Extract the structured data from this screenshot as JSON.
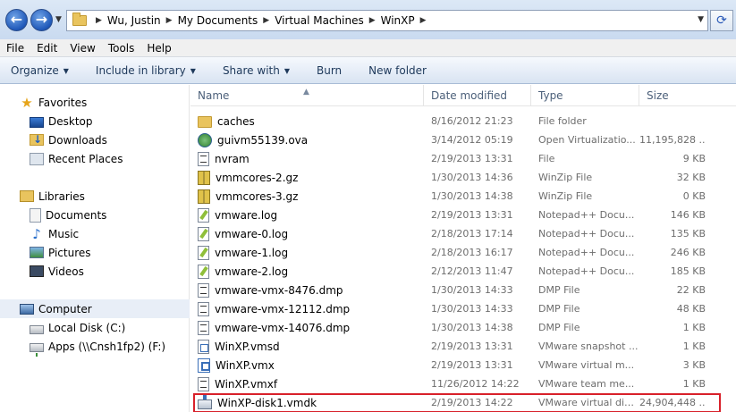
{
  "address": {
    "breadcrumbs": [
      "Wu, Justin",
      "My Documents",
      "Virtual Machines",
      "WinXP"
    ]
  },
  "menu": [
    "File",
    "Edit",
    "View",
    "Tools",
    "Help"
  ],
  "commands": {
    "organize": "Organize",
    "include_in_library": "Include in library",
    "share_with": "Share with",
    "burn": "Burn",
    "new_folder": "New folder"
  },
  "nav": {
    "favorites": "Favorites",
    "desktop": "Desktop",
    "downloads": "Downloads",
    "recent_places": "Recent Places",
    "libraries": "Libraries",
    "documents": "Documents",
    "music": "Music",
    "pictures": "Pictures",
    "videos": "Videos",
    "computer": "Computer",
    "local_disk": "Local Disk (C:)",
    "apps": "Apps (\\\\Cnsh1fp2) (F:)"
  },
  "columns": {
    "name": "Name",
    "date_modified": "Date modified",
    "type": "Type",
    "size": "Size"
  },
  "files": [
    {
      "name": "caches",
      "date": "8/16/2012 21:23",
      "type": "File folder",
      "size": "",
      "icon": "folder-icon"
    },
    {
      "name": "guivm55139.ova",
      "date": "3/14/2012 05:19",
      "type": "Open Virtualizatio...",
      "size": "11,195,828 ...",
      "icon": "ova-icon"
    },
    {
      "name": "nvram",
      "date": "2/19/2013 13:31",
      "type": "File",
      "size": "9 KB",
      "icon": "file-icon"
    },
    {
      "name": "vmmcores-2.gz",
      "date": "1/30/2013 14:36",
      "type": "WinZip File",
      "size": "32 KB",
      "icon": "zip-icon"
    },
    {
      "name": "vmmcores-3.gz",
      "date": "1/30/2013 14:38",
      "type": "WinZip File",
      "size": "0 KB",
      "icon": "zip-icon"
    },
    {
      "name": "vmware.log",
      "date": "2/19/2013 13:31",
      "type": "Notepad++ Docu...",
      "size": "146 KB",
      "icon": "notepad-icon"
    },
    {
      "name": "vmware-0.log",
      "date": "2/18/2013 17:14",
      "type": "Notepad++ Docu...",
      "size": "135 KB",
      "icon": "notepad-icon"
    },
    {
      "name": "vmware-1.log",
      "date": "2/18/2013 16:17",
      "type": "Notepad++ Docu...",
      "size": "246 KB",
      "icon": "notepad-icon"
    },
    {
      "name": "vmware-2.log",
      "date": "2/12/2013 11:47",
      "type": "Notepad++ Docu...",
      "size": "185 KB",
      "icon": "notepad-icon"
    },
    {
      "name": "vmware-vmx-8476.dmp",
      "date": "1/30/2013 14:33",
      "type": "DMP File",
      "size": "22 KB",
      "icon": "file-icon"
    },
    {
      "name": "vmware-vmx-12112.dmp",
      "date": "1/30/2013 14:33",
      "type": "DMP File",
      "size": "48 KB",
      "icon": "file-icon"
    },
    {
      "name": "vmware-vmx-14076.dmp",
      "date": "1/30/2013 14:38",
      "type": "DMP File",
      "size": "1 KB",
      "icon": "file-icon"
    },
    {
      "name": "WinXP.vmsd",
      "date": "2/19/2013 13:31",
      "type": "VMware snapshot ...",
      "size": "1 KB",
      "icon": "vmsd-icon"
    },
    {
      "name": "WinXP.vmx",
      "date": "2/19/2013 13:31",
      "type": "VMware virtual m...",
      "size": "3 KB",
      "icon": "vmx-icon"
    },
    {
      "name": "WinXP.vmxf",
      "date": "11/26/2012 14:22",
      "type": "VMware team me...",
      "size": "1 KB",
      "icon": "vmxf-icon"
    },
    {
      "name": "WinXP-disk1.vmdk",
      "date": "2/19/2013 14:22",
      "type": "VMware virtual dis...",
      "size": "24,904,448 ...",
      "icon": "vmdk-icon"
    }
  ],
  "colors": {
    "highlight": "#d8202a",
    "header_text": "#4c607a",
    "command_text": "#1e395b"
  }
}
